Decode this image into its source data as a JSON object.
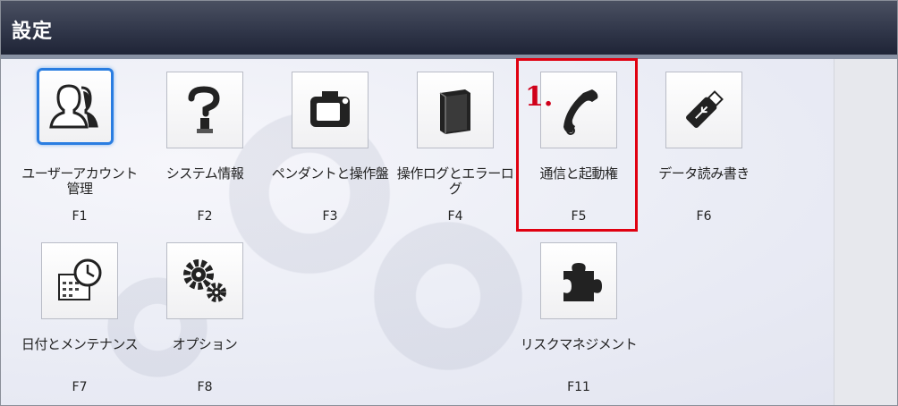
{
  "window": {
    "title": "設定"
  },
  "tiles": [
    {
      "label": "ユーザーアカウント管理",
      "key": "F1",
      "icon": "user-accounts-icon"
    },
    {
      "label": "システム情報",
      "key": "F2",
      "icon": "robot-arm-info-icon"
    },
    {
      "label": "ペンダントと操作盤",
      "key": "F3",
      "icon": "pendant-icon"
    },
    {
      "label": "操作ログとエラーログ",
      "key": "F4",
      "icon": "log-book-icon"
    },
    {
      "label": "通信と起動権",
      "key": "F5",
      "icon": "phone-handset-icon"
    },
    {
      "label": "データ読み書き",
      "key": "F6",
      "icon": "usb-drive-icon"
    },
    {
      "label": "日付とメンテナンス",
      "key": "F7",
      "icon": "clock-calendar-icon"
    },
    {
      "label": "オプション",
      "key": "F8",
      "icon": "gears-icon"
    },
    {
      "label": "リスクマネジメント",
      "key": "F11",
      "icon": "puzzle-piece-icon"
    }
  ],
  "annotation": {
    "text": "1."
  },
  "colors": {
    "titlebar": "#31374a",
    "selection": "#2a7de1",
    "highlight": "#e00010"
  }
}
